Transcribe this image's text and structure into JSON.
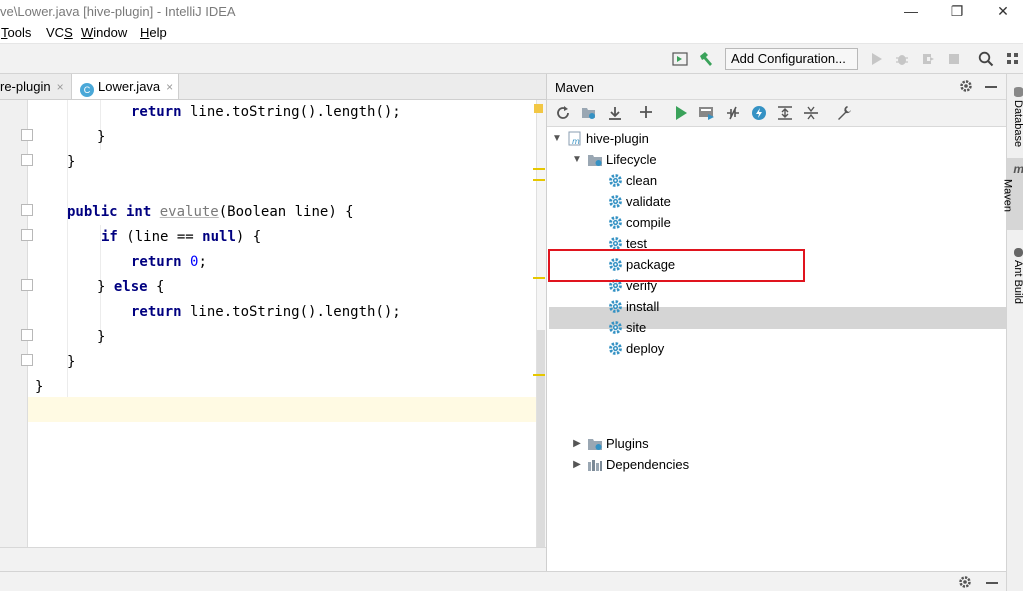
{
  "window": {
    "title": "ve\\Lower.java [hive-plugin] - IntelliJ IDEA",
    "minimize_glyph": "—",
    "restore_glyph": "❐",
    "close_glyph": "✕"
  },
  "menu": {
    "tools_u": "T",
    "tools_rest": "ools",
    "vcs_pre": "VC",
    "vcs_u": "S",
    "window_u": "W",
    "window_rest": "indow",
    "help_u": "H",
    "help_rest": "elp"
  },
  "toolbar": {
    "add_configuration": "Add Configuration..."
  },
  "editor_tabs": [
    {
      "label": "re-plugin",
      "close": "×"
    },
    {
      "label": "Lower.java",
      "icon_letter": "C",
      "close": "×"
    }
  ],
  "code": [
    {
      "indent": "        ",
      "tokens": [
        {
          "t": "return",
          "c": "kw"
        },
        {
          "t": " line.toString().length();",
          "c": ""
        }
      ]
    },
    {
      "indent": "      ",
      "tokens": [
        {
          "t": "}",
          "c": ""
        }
      ]
    },
    {
      "indent": "    ",
      "tokens": [
        {
          "t": "}",
          "c": ""
        }
      ]
    },
    {
      "indent": "",
      "tokens": []
    },
    {
      "indent": "    ",
      "tokens": [
        {
          "t": "public int",
          "c": "kw"
        },
        {
          "t": " ",
          "c": ""
        },
        {
          "t": "evalute",
          "c": "fn"
        },
        {
          "t": "(Boolean line) {",
          "c": ""
        }
      ]
    },
    {
      "indent": "      ",
      "tokens": [
        {
          "t": "if",
          "c": "kw"
        },
        {
          "t": " (line == ",
          "c": ""
        },
        {
          "t": "null",
          "c": "kw"
        },
        {
          "t": ") {",
          "c": ""
        }
      ]
    },
    {
      "indent": "        ",
      "tokens": [
        {
          "t": "return",
          "c": "kw"
        },
        {
          "t": " ",
          "c": ""
        },
        {
          "t": "0",
          "c": "num"
        },
        {
          "t": ";",
          "c": ""
        }
      ]
    },
    {
      "indent": "      ",
      "tokens": [
        {
          "t": "} ",
          "c": ""
        },
        {
          "t": "else",
          "c": "kw"
        },
        {
          "t": " {",
          "c": ""
        }
      ]
    },
    {
      "indent": "        ",
      "tokens": [
        {
          "t": "return",
          "c": "kw"
        },
        {
          "t": " line.toString().length();",
          "c": ""
        }
      ]
    },
    {
      "indent": "      ",
      "tokens": [
        {
          "t": "}",
          "c": ""
        }
      ]
    },
    {
      "indent": "    ",
      "tokens": [
        {
          "t": "}",
          "c": ""
        }
      ]
    },
    {
      "indent": "  ",
      "tokens": [
        {
          "t": "}",
          "c": ""
        }
      ]
    }
  ],
  "maven": {
    "title": "Maven",
    "project": "hive-plugin",
    "lifecycle": "Lifecycle",
    "phases": [
      "clean",
      "validate",
      "compile",
      "test",
      "package",
      "verify",
      "install",
      "site",
      "deploy"
    ],
    "selected_phase": "package",
    "plugins": "Plugins",
    "dependencies": "Dependencies"
  },
  "right_strip": {
    "database": "Database",
    "maven": "Maven",
    "ant_build": "Ant Build"
  },
  "colors": {
    "accent_green": "#3aa25a",
    "gear_blue": "#3592c4",
    "highlight_red": "#e0141e"
  }
}
